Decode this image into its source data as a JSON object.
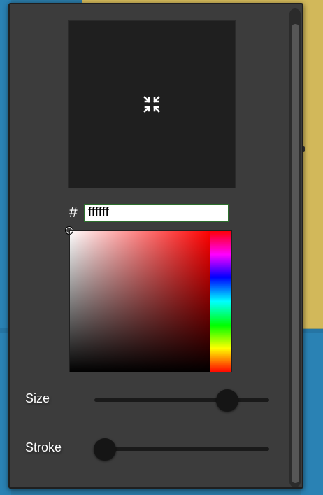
{
  "color_picker": {
    "hash_label": "#",
    "hex_value": "ffffff",
    "hue_color": "#ff0000",
    "selected_color": "#ffffff"
  },
  "preview": {
    "icon": "collapse-arrows-icon"
  },
  "sliders": {
    "size": {
      "label": "Size",
      "value": 0.76
    },
    "stroke": {
      "label": "Stroke",
      "value": 0.06
    }
  },
  "colors": {
    "panel_bg": "#3c3c3c",
    "preview_bg": "#1f1f1f",
    "input_border": "#2c6f2c",
    "thumb": "#151515"
  }
}
